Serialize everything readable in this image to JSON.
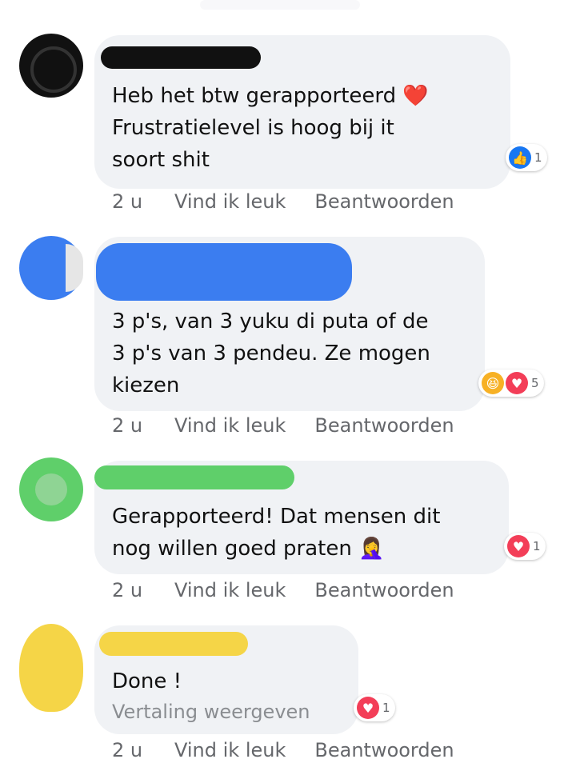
{
  "comments": [
    {
      "text": "Heb het btw gerapporteerd ❤️\nFrustratielevel is hoog bij it\nsoort shit",
      "reaction": {
        "icons": [
          "like-icon"
        ],
        "count": "1"
      },
      "time": "2 u",
      "like_label": "Vind ik leuk",
      "reply_label": "Beantwoorden"
    },
    {
      "text": "3 p's, van 3 yuku di puta of de\n3 p's van 3 pendeu. Ze mogen\nkiezen",
      "reaction": {
        "icons": [
          "haha-icon",
          "love-icon"
        ],
        "count": "5"
      },
      "time": "2 u",
      "like_label": "Vind ik leuk",
      "reply_label": "Beantwoorden"
    },
    {
      "text": "Gerapporteerd! Dat mensen dit\nnog willen goed praten 🤦‍♀️",
      "reaction": {
        "icons": [
          "love-icon"
        ],
        "count": "1"
      },
      "time": "2 u",
      "like_label": "Vind ik leuk",
      "reply_label": "Beantwoorden"
    },
    {
      "text": "Done !",
      "translate_label": "Vertaling weergeven",
      "reaction": {
        "icons": [
          "love-icon"
        ],
        "count": "1"
      },
      "time": "2 u",
      "like_label": "Vind ik leuk",
      "reply_label": "Beantwoorden"
    }
  ],
  "colors": {
    "bubble": "#f0f2f5",
    "redact_black": "#111111",
    "redact_blue": "#3b7df0",
    "redact_green": "#5fcf6a",
    "redact_yellow": "#f5d547",
    "like": "#1877f2",
    "love": "#f33e58",
    "haha": "#f7b125",
    "meta_text": "#65676b"
  }
}
